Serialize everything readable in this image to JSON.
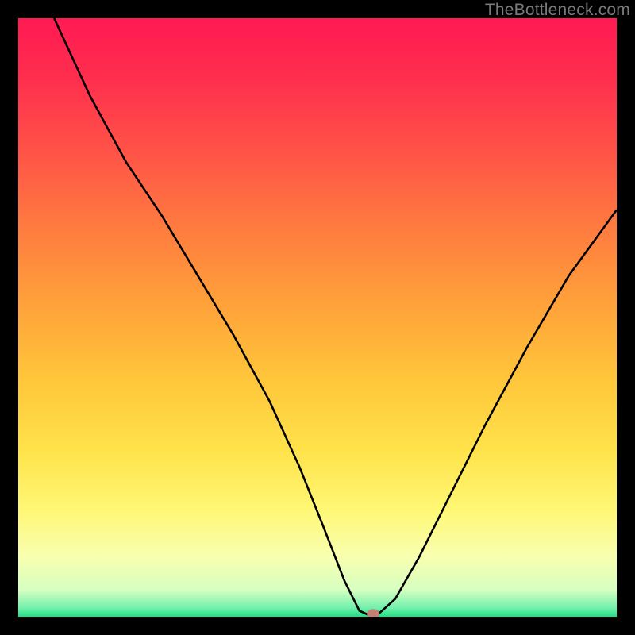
{
  "watermark": "TheBottleneck.com",
  "chart_data": {
    "type": "line",
    "title": "",
    "xlabel": "",
    "ylabel": "",
    "xlim": [
      0,
      100
    ],
    "ylim": [
      0,
      100
    ],
    "series": [
      {
        "name": "bottleneck-curve",
        "x": [
          6,
          12,
          18,
          24,
          30,
          36,
          42,
          47,
          51,
          54.5,
          57,
          58.5,
          60,
          63,
          67,
          72,
          78,
          85,
          92,
          100
        ],
        "y": [
          100,
          87,
          76,
          67,
          57,
          47,
          36,
          25,
          15,
          6,
          1,
          0.3,
          0.3,
          3,
          10,
          20,
          32,
          45,
          57,
          68
        ],
        "color": "#000000",
        "width": 2.6
      }
    ],
    "marker": {
      "x": 59.3,
      "y": 0.5,
      "rx": 8,
      "ry": 6,
      "color": "#c48074"
    },
    "background_gradient": {
      "stops": [
        {
          "offset": 0.0,
          "color": "#ff1a52"
        },
        {
          "offset": 0.1,
          "color": "#ff2e4e"
        },
        {
          "offset": 0.22,
          "color": "#ff5247"
        },
        {
          "offset": 0.35,
          "color": "#ff7b3f"
        },
        {
          "offset": 0.48,
          "color": "#ffa23a"
        },
        {
          "offset": 0.6,
          "color": "#ffc53a"
        },
        {
          "offset": 0.72,
          "color": "#ffe24a"
        },
        {
          "offset": 0.82,
          "color": "#fff774"
        },
        {
          "offset": 0.9,
          "color": "#f8ffb0"
        },
        {
          "offset": 0.955,
          "color": "#d6ffc0"
        },
        {
          "offset": 0.985,
          "color": "#74f0ad"
        },
        {
          "offset": 1.0,
          "color": "#1fe084"
        }
      ]
    }
  }
}
